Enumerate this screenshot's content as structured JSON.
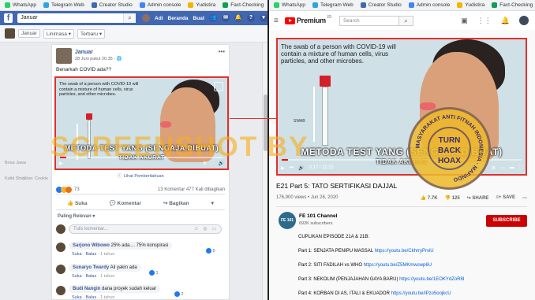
{
  "bookmarks": [
    "WhatsApp",
    "Telegram Web",
    "Creator Studio",
    "Admin console",
    "Yudistira",
    "Fact-Checking"
  ],
  "watermark": "SCREENSHOT BY",
  "stamp": {
    "line1": "TURN",
    "line2": "BACK",
    "line3": "HOAX",
    "ring": "MASYARAKAT ANTI FITNAH INDONESIA · MAFINDO"
  },
  "colors": {
    "fb_blue": "#4267b2",
    "yt_red": "#ff0000",
    "highlight": "#e0302c",
    "watermark": "#f7af1e"
  },
  "facebook": {
    "search_value": "Januar",
    "nav": {
      "user": "Adi",
      "home": "Beranda",
      "create": "Buat"
    },
    "filter": {
      "name": "Januar",
      "view": "Linimasa",
      "sort": "Terbaru"
    },
    "left_links": [
      "Bosa Jawa",
      "Kalid Shiq",
      "Iklan",
      "Cookie"
    ],
    "post": {
      "author": "Januar",
      "date": "28 Juni pukul 20.35 · 🌐",
      "text": "Benarkah COVID ada??",
      "video_text": "The swab of a person with COVID-19 will contain a mixture of human cells, virus particles, and other microbes.",
      "subtitle_1": "METODA TEST YANG (SENGAJA DIBUAT)",
      "subtitle_2": "TIDAK AKURAT",
      "translation_link": "Lihat Pemberitahuan",
      "reaction_count": "73",
      "comments_count": "13 Komentar",
      "views_count": "477 Kali dibagikan",
      "like": "Suka",
      "comment": "Komentar",
      "share": "Bagikan",
      "sort_label": "Paling Relevan ▾",
      "comment_placeholder": "Tulis komentar...",
      "comments": [
        {
          "name": "Sarjono Wibowo",
          "text": "25% ada.... 75% konspirasi",
          "like": "Suka",
          "reply": "Balas",
          "time": "1 tahun",
          "count": "5"
        },
        {
          "name": "Sunaryo Twardy",
          "text": "Ali yakin ada",
          "like": "Suka",
          "reply": "Balas",
          "time": "1 tahun",
          "count": "1"
        },
        {
          "name": "Budi Nangin",
          "text": "dana proyek sudah keluar",
          "like": "Suka",
          "reply": "Balas",
          "time": "1 tahun",
          "count": "2"
        }
      ]
    }
  },
  "youtube": {
    "brand": "Premium",
    "region": "ID",
    "search_placeholder": "Search",
    "video_text": "The swab of a person with COVID-19 will contain a mixture of human cells, virus particles, and other microbes.",
    "swab_label": "SWAB",
    "subtitle_1": "METODA TEST YANG (SENGAJA DIBUAT)",
    "subtitle_2": "TIDAK AKURAT",
    "time": "0:17 / 11:15",
    "progress": 0.025,
    "title": "E21 Part 5: TATO SERTIFIKASI DAJJAL",
    "views": "176,900 views • Jun 26, 2020",
    "likes": "7.7K",
    "dislikes": "125",
    "share": "SHARE",
    "save": "SAVE",
    "channel": {
      "avatar_text": "FE 101",
      "name": "FE 101 Channel",
      "subs": "692K subscribers",
      "subscribe": "SUBSCRIBE"
    },
    "description": [
      {
        "label": "CUPLIKAN EPISODE 21A & 21B:",
        "link": ""
      },
      {
        "label": "Part 1: SENJATA PENIPU MASSAL ",
        "link": "https://youtu.be/CkhrryPrviU"
      },
      {
        "label": "Part 2: SITI FADILAH vs WHO ",
        "link": "https://youtu.be/Z5MKmwswp6U"
      },
      {
        "label": "Part 3: NEKOLIM (PENJAJAHAN GAYA BARU) ",
        "link": "https://youtu.be/1EOKYdZoR8I"
      },
      {
        "label": "Part 4: KORBAN DI AS, ITALI & EKUADOR ",
        "link": "https://youtu.be/lPzo5oojkcU"
      }
    ]
  }
}
